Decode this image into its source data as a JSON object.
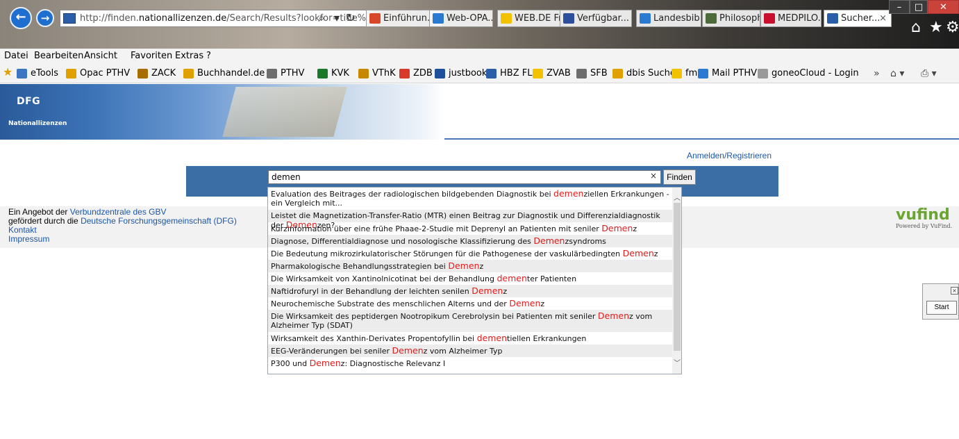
{
  "browser": {
    "url_prefix": "http://finden.",
    "url_domain": "nationallizenzen.de",
    "url_rest": "/Search/Results?lookfor=title%.",
    "tabs": [
      {
        "label": "Einführun...",
        "color": "#d9472b"
      },
      {
        "label": "Web-OPA...",
        "color": "#2a7ad1"
      },
      {
        "label": "WEB.DE Fr...",
        "color": "#f2c200"
      },
      {
        "label": "Verfügbar...",
        "color": "#2d4e9a"
      },
      {
        "label": "Landesbib...",
        "color": "#2a7ad1"
      },
      {
        "label": "Philosophi...",
        "color": "#4d6b3a"
      },
      {
        "label": "MEDPILO...",
        "color": "#c8102e"
      },
      {
        "label": "Sucher...",
        "color": "#2b5ea8",
        "active": true
      }
    ],
    "tab_close": "×"
  },
  "menubar": [
    "Datei",
    "Bearbeiten",
    "Ansicht",
    "Favoriten",
    "Extras",
    "?"
  ],
  "favorites": [
    {
      "label": "eTools",
      "color": "#3b76c3"
    },
    {
      "label": "Opac PTHV",
      "color": "#e0a000"
    },
    {
      "label": "ZACK",
      "color": "#a86d00"
    },
    {
      "label": "Buchhandel.de",
      "color": "#e0a000"
    },
    {
      "label": "PTHV",
      "color": "#6d6d6d"
    },
    {
      "label": "KVK",
      "color": "#1a7a2a"
    },
    {
      "label": "VThK",
      "color": "#c78800"
    },
    {
      "label": "ZDB",
      "color": "#d83a2b"
    },
    {
      "label": "justbooks",
      "color": "#1e4f9a"
    },
    {
      "label": "HBZ FL",
      "color": "#2d5ea8"
    },
    {
      "label": "ZVAB",
      "color": "#f2c200"
    },
    {
      "label": "SFB",
      "color": "#6d6d6d"
    },
    {
      "label": "dbis Suche",
      "color": "#e0a000"
    },
    {
      "label": "fm",
      "color": "#f2c200"
    },
    {
      "label": "Mail PTHV",
      "color": "#2a7ad1"
    },
    {
      "label": "goneoCloud - Login",
      "color": "#9a9a9a"
    }
  ],
  "header": {
    "logo": "DFG",
    "subtitle": "Nationallizenzen"
  },
  "search": {
    "login_link": "Anmelden/Registrieren",
    "query": "demen",
    "clear": "×",
    "button": "Finden"
  },
  "suggestions": [
    {
      "pre": "Evaluation des Beitrages der radiologischen bildgebenden Diagnostik bei ",
      "hl": "demen",
      "post": "ziellen Erkrankungen - ein Vergleich mit..."
    },
    {
      "pre": "Leistet die Magnetization-Transfer-Ratio (MTR) einen Beitrag zur Diagnostik und Differenzialdiagnostik der ",
      "hl": "Demen",
      "post": "zen?"
    },
    {
      "pre": "Kurzinformation über eine frühe Phaae-2-Studie mit Deprenyl an Patienten mit seniler ",
      "hl": "Demen",
      "post": "z"
    },
    {
      "pre": "Diagnose, Differentialdiagnose und nosologische Klassifizierung des ",
      "hl": "Demen",
      "post": "zsyndroms"
    },
    {
      "pre": "Die Bedeutung mikrozirkulatorischer Störungen für die Pathogenese der vaskulärbedingten ",
      "hl": "Demen",
      "post": "z"
    },
    {
      "pre": "Pharmakologische Behandlungsstrategien bei ",
      "hl": "Demen",
      "post": "z"
    },
    {
      "pre": "Die Wirksamkeit von Xantinolnicotinat bei der Behandlung ",
      "hl": "demen",
      "post": "ter Patienten"
    },
    {
      "pre": "Naftidrofuryl in der Behandlung der leichten senilen ",
      "hl": "Demen",
      "post": "z"
    },
    {
      "pre": "Neurochemische Substrate des menschlichen Alterns und der ",
      "hl": "Demen",
      "post": "z"
    },
    {
      "pre": "Die Wirksamkeit des peptidergen Nootropikum Cerebrolysin bei Patienten mit seniler ",
      "hl": "Demen",
      "post": "z vom Alzheimer Typ (SDAT)"
    },
    {
      "pre": "Wirksamkeit des Xanthin-Derivates Propentofyllin bei ",
      "hl": "demen",
      "post": "tiellen Erkrankungen"
    },
    {
      "pre": "EEG-Veränderungen bei seniler ",
      "hl": "Demen",
      "post": "z vom Alzheimer Typ"
    },
    {
      "pre": "P300 und ",
      "hl": "Demen",
      "post": "z: Diagnostische Relevanz I"
    }
  ],
  "footer": {
    "line1_pre": "Ein Angebot der ",
    "line1_link": "Verbundzentrale des GBV",
    "line2_pre": "gefördert durch die ",
    "line2_link": "Deutsche Forschungsgemeinschaft (DFG)",
    "kontakt": "Kontakt",
    "impressum": "Impressum"
  },
  "vufind": {
    "word": "vufind",
    "powered": "Powered by VuFind."
  },
  "widget": {
    "close": "×",
    "start": "Start"
  }
}
